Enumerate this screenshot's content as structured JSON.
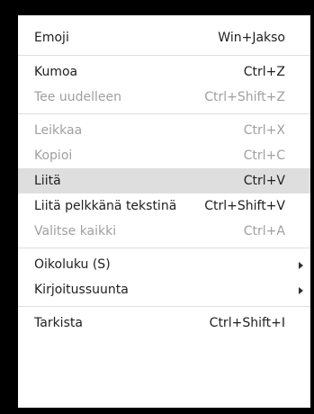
{
  "menu": {
    "items": [
      {
        "label": "Emoji",
        "shortcut": "Win+Jakso"
      },
      {
        "label": "Kumoa",
        "shortcut": "Ctrl+Z"
      },
      {
        "label": "Tee uudelleen",
        "shortcut": "Ctrl+Shift+Z"
      },
      {
        "label": "Leikkaa",
        "shortcut": "Ctrl+X"
      },
      {
        "label": "Kopioi",
        "shortcut": "Ctrl+C"
      },
      {
        "label": "Liitä",
        "shortcut": "Ctrl+V"
      },
      {
        "label": "Liitä pelkkänä tekstinä",
        "shortcut": "Ctrl+Shift+V"
      },
      {
        "label": "Valitse kaikki",
        "shortcut": "Ctrl+A"
      },
      {
        "label": "Oikoluku (S)",
        "shortcut": ""
      },
      {
        "label": "Kirjoitussuunta",
        "shortcut": ""
      },
      {
        "label": "Tarkista",
        "shortcut": "Ctrl+Shift+I"
      }
    ]
  },
  "colors": {
    "text": "#202020",
    "disabled_text": "#a0a0a0",
    "highlight": "#dedede",
    "separator": "#dedede",
    "frame": "#000000"
  }
}
